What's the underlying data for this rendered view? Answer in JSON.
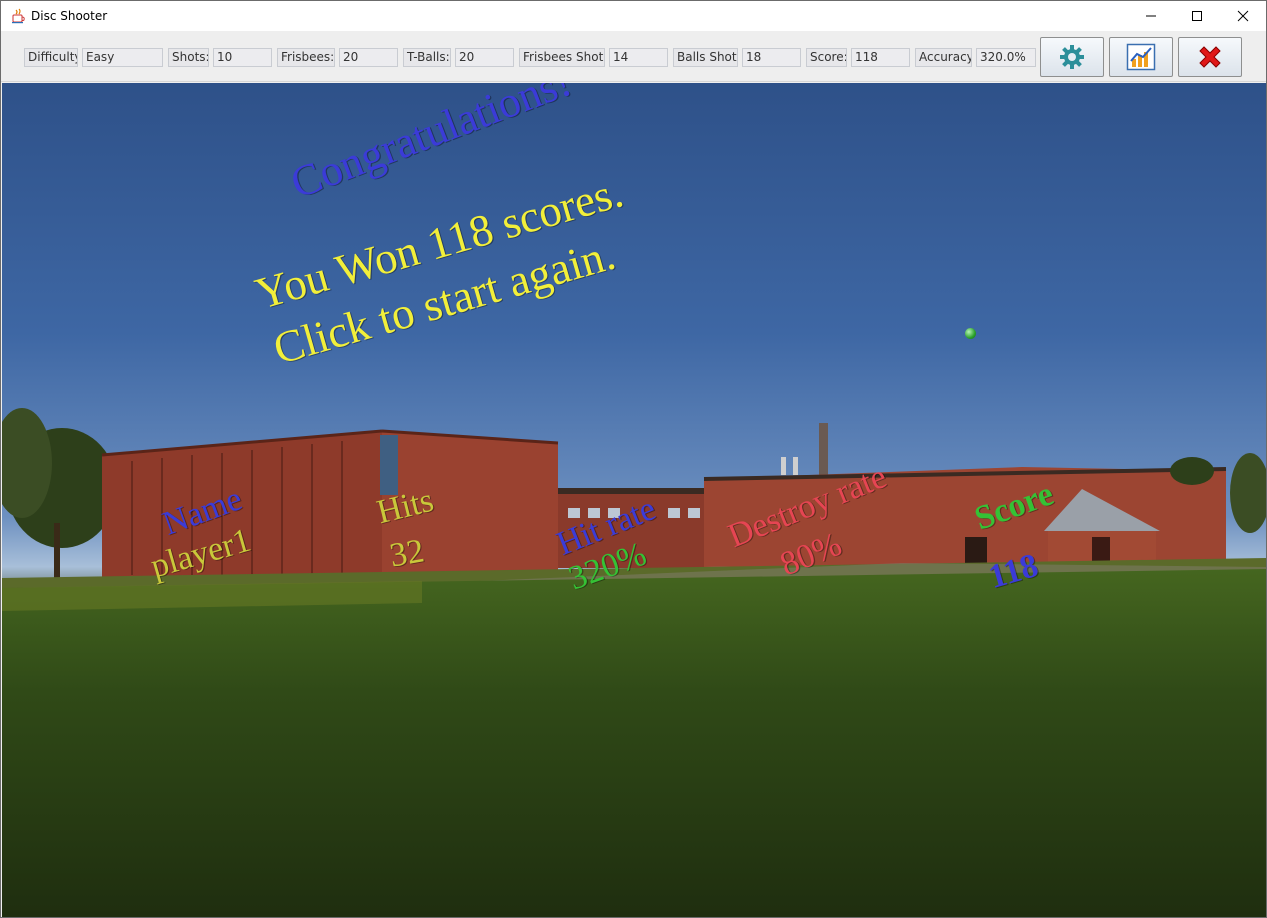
{
  "window": {
    "title": "Disc Shooter",
    "icons": {
      "app": "java-coffee-icon",
      "minimize": "minimize-icon",
      "maximize": "maximize-icon",
      "close": "close-icon"
    }
  },
  "toolbar": {
    "difficulty_label": "Difficulty:",
    "difficulty_value": "Easy",
    "shots_label": "Shots:",
    "shots_value": "10",
    "frisbees_label": "Frisbees:",
    "frisbees_value": "20",
    "tballs_label": "T-Balls:",
    "tballs_value": "20",
    "frisbees_shot_label": "Frisbees Shot:",
    "frisbees_shot_value": "14",
    "balls_shot_label": "Balls Shot:",
    "balls_shot_value": "18",
    "score_label": "Score:",
    "score_value": "118",
    "accuracy_label": "Accuracy:",
    "accuracy_value": "320.0%",
    "buttons": {
      "settings": "gear-icon",
      "stats": "chart-icon",
      "exit": "red-x-icon"
    }
  },
  "game": {
    "headline": "Congratulations!",
    "message_line1": "You Won 118 scores.",
    "message_line2": "Click to start again.",
    "results": {
      "name_label": "Name",
      "name_value": "player1",
      "hits_label": "Hits",
      "hits_value": "32",
      "hit_rate_label": "Hit rate",
      "hit_rate_value": "320%",
      "destroy_rate_label": "Destroy rate",
      "destroy_rate_value": "80%",
      "score_label": "Score",
      "score_value": "118"
    },
    "colors": {
      "blue": "#3b3bd8",
      "yellow": "#f2ef3a",
      "olive": "#c9c83a",
      "green": "#35c235",
      "red": "#e64553"
    }
  }
}
